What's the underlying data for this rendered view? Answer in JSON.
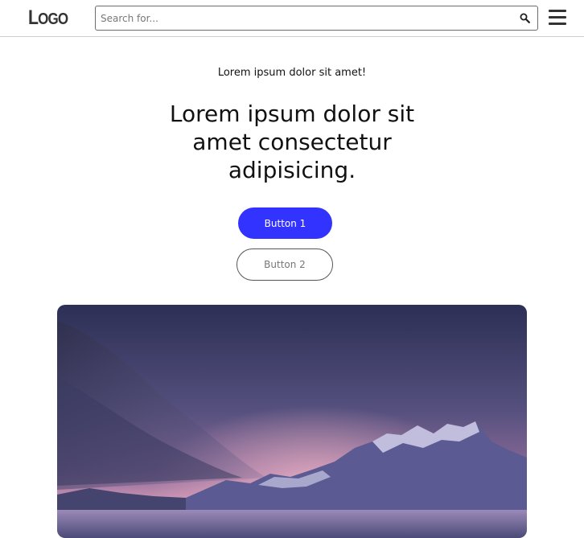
{
  "header": {
    "logo_big": "L",
    "logo_small": "OGO",
    "search_placeholder": "Search for..."
  },
  "main": {
    "kicker": "Lorem ipsum dolor sit amet!",
    "headline": "Lorem ipsum dolor sit amet consectetur adipisicing.",
    "button1_label": "Button 1",
    "button2_label": "Button 2"
  },
  "icons": {
    "search": "search-icon",
    "menu": "hamburger-menu-icon"
  },
  "colors": {
    "primary": "#3333ff",
    "border": "#6b6b6b"
  }
}
